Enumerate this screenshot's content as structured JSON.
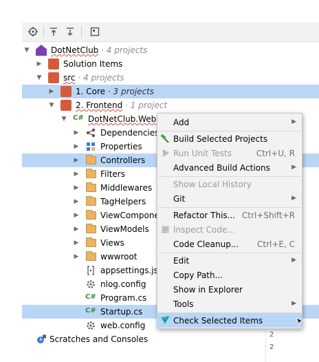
{
  "toolbar": {
    "buttons": [
      "locate-icon",
      "collapse-all-icon",
      "expand-all-icon",
      "show-solution-view-icon"
    ]
  },
  "tree": {
    "solution": {
      "name": "DotNetClub",
      "meta": "· 4 projects"
    },
    "items": [
      {
        "label": "Solution Items"
      },
      {
        "label": "src",
        "meta": "· 4 projects"
      },
      {
        "label": "1. Core",
        "meta": "· 3 projects"
      },
      {
        "label": "2. Frontend",
        "meta": "· 1 project"
      },
      {
        "label": "DotNetClub.Web"
      },
      {
        "label": "Dependencies"
      },
      {
        "label": "Properties"
      },
      {
        "label": "Controllers"
      },
      {
        "label": "Filters"
      },
      {
        "label": "Middlewares"
      },
      {
        "label": "TagHelpers"
      },
      {
        "label": "ViewComponents"
      },
      {
        "label": "ViewModels"
      },
      {
        "label": "Views"
      },
      {
        "label": "wwwroot"
      },
      {
        "label": "appsettings.json"
      },
      {
        "label": "nlog.config"
      },
      {
        "label": "Program.cs"
      },
      {
        "label": "Startup.cs"
      },
      {
        "label": "web.config"
      }
    ],
    "scratches": "Scratches and Consoles"
  },
  "gutter": {
    "lines": [
      "2",
      "2",
      "2"
    ]
  },
  "context_menu": {
    "items": [
      {
        "label": "Add",
        "submenu": true
      },
      {
        "label": "Build Selected Projects",
        "icon": "hammer-icon"
      },
      {
        "label": "Run Unit Tests",
        "shortcut": "Ctrl+U, R",
        "disabled": true,
        "icon": "run-icon"
      },
      {
        "label": "Advanced Build Actions",
        "submenu": true
      },
      {
        "label": "Show Local History",
        "disabled": true
      },
      {
        "label": "Git",
        "submenu": true
      },
      {
        "label": "Refactor This...",
        "shortcut": "Ctrl+Shift+R"
      },
      {
        "label": "Inspect Code...",
        "disabled": true,
        "icon": "inspect-icon"
      },
      {
        "label": "Code Cleanup...",
        "shortcut": "Ctrl+E, C"
      },
      {
        "label": "Edit",
        "submenu": true
      },
      {
        "label": "Copy Path..."
      },
      {
        "label": "Show in Explorer"
      },
      {
        "label": "Tools",
        "submenu": true
      },
      {
        "label": "Check Selected Items",
        "icon": "check-icon"
      }
    ]
  }
}
